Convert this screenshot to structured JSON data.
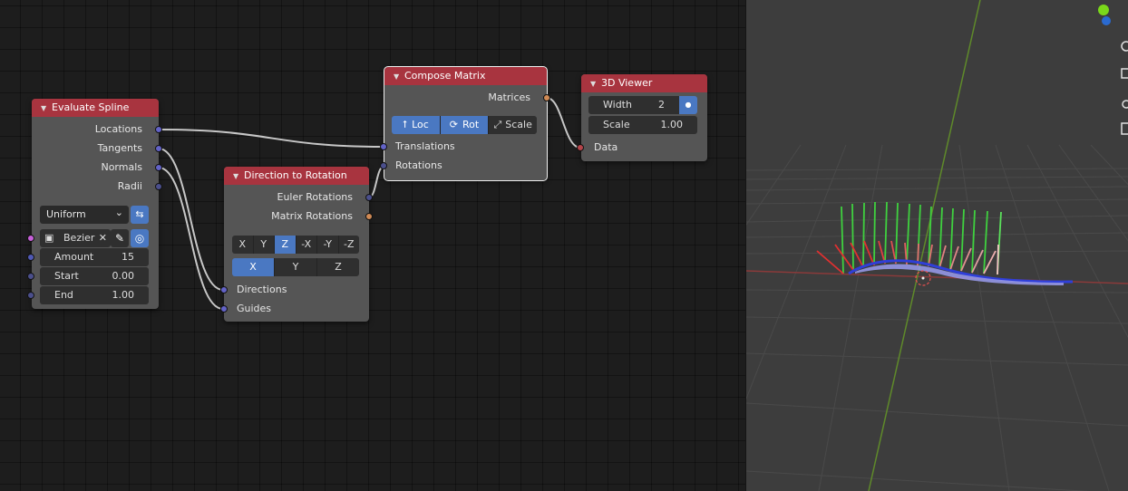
{
  "nodes": {
    "evaluate_spline": {
      "title": "Evaluate Spline",
      "outputs": [
        "Locations",
        "Tangents",
        "Normals",
        "Radii"
      ],
      "mode_dropdown": "Uniform",
      "spline_field": "Bezier",
      "amount_label": "Amount",
      "amount_value": "15",
      "start_label": "Start",
      "start_value": "0.00",
      "end_label": "End",
      "end_value": "1.00"
    },
    "direction_to_rotation": {
      "title": "Direction to Rotation",
      "outputs": [
        "Euler Rotations",
        "Matrix Rotations"
      ],
      "direction_axes": [
        "X",
        "Y",
        "Z",
        "-X",
        "-Y",
        "-Z"
      ],
      "direction_selected": "Z",
      "guide_axes": [
        "X",
        "Y",
        "Z"
      ],
      "guide_selected": "X",
      "inputs": [
        "Directions",
        "Guides"
      ]
    },
    "compose_matrix": {
      "title": "Compose Matrix",
      "outputs": [
        "Matrices"
      ],
      "toggles": [
        "Loc",
        "Rot",
        "Scale"
      ],
      "inputs": [
        "Translations",
        "Rotations"
      ]
    },
    "viewer_3d": {
      "title": "3D Viewer",
      "width_label": "Width",
      "width_value": "2",
      "scale_label": "Scale",
      "scale_value": "1.00",
      "inputs": [
        "Data"
      ]
    }
  },
  "colors": {
    "node_header": "#a8343f",
    "node_body": "#555555",
    "toggle_active": "#4a78c2",
    "vector_socket": "#6363c7",
    "matrix_socket": "#d08a55",
    "generic_socket": "#b5454b"
  },
  "icons": {
    "header_collapse": "chevron-down-icon",
    "spline_object": "spline-object-icon",
    "clear": "close-icon",
    "eyedropper": "eyedropper-icon",
    "refresh": "globe-icon",
    "loc": "arrow-up-icon",
    "rot": "rotate-icon",
    "scale": "scale-icon"
  },
  "glyphs": {
    "chevron": "▼",
    "clear": "✕",
    "eyedropper": "✎",
    "globe": "◎",
    "dropdown_arrow": "⌄",
    "loc": "⭡",
    "rot": "⟳",
    "scale": "⤢",
    "radio": "●",
    "arrows": "⇆",
    "spline": "▣"
  }
}
